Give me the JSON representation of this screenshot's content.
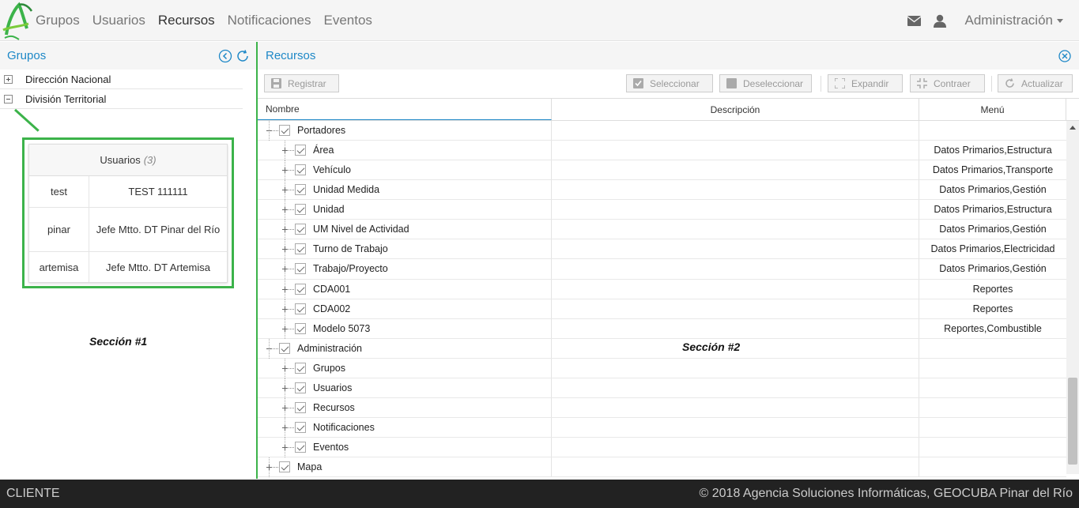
{
  "nav": {
    "items": [
      "Grupos",
      "Usuarios",
      "Recursos",
      "Notificaciones",
      "Eventos"
    ],
    "active": "Recursos",
    "admin_label": "Administración"
  },
  "left_panel": {
    "title": "Grupos",
    "tree": [
      "Dirección Nacional",
      "División Territorial"
    ],
    "popup": {
      "title": "Usuarios",
      "count": "(3)",
      "rows": [
        {
          "user": "test",
          "name": "TEST 111111"
        },
        {
          "user": "pinar",
          "name": "Jefe Mtto. DT Pinar del Río"
        },
        {
          "user": "artemisa",
          "name": "Jefe Mtto. DT Artemisa"
        }
      ]
    },
    "section_label": "Sección #1"
  },
  "right_panel": {
    "title": "Recursos",
    "toolbar": {
      "registrar": "Registrar",
      "seleccionar": "Seleccionar",
      "deseleccionar": "Deseleccionar",
      "expandir": "Expandir",
      "contraer": "Contraer",
      "actualizar": "Actualizar"
    },
    "columns": {
      "name": "Nombre",
      "desc": "Descripción",
      "menu": "Menú"
    },
    "rows": [
      {
        "level": 0,
        "name": "Portadores",
        "menu": "",
        "expanded": true
      },
      {
        "level": 1,
        "name": "Área",
        "menu": "Datos Primarios,Estructura"
      },
      {
        "level": 1,
        "name": "Vehículo",
        "menu": "Datos Primarios,Transporte"
      },
      {
        "level": 1,
        "name": "Unidad Medida",
        "menu": "Datos Primarios,Gestión"
      },
      {
        "level": 1,
        "name": "Unidad",
        "menu": "Datos Primarios,Estructura"
      },
      {
        "level": 1,
        "name": "UM Nivel de Actividad",
        "menu": "Datos Primarios,Gestión"
      },
      {
        "level": 1,
        "name": "Turno de Trabajo",
        "menu": "Datos Primarios,Electricidad"
      },
      {
        "level": 1,
        "name": "Trabajo/Proyecto",
        "menu": "Datos Primarios,Gestión"
      },
      {
        "level": 1,
        "name": "CDA001",
        "menu": "Reportes"
      },
      {
        "level": 1,
        "name": "CDA002",
        "menu": "Reportes"
      },
      {
        "level": 1,
        "name": "Modelo 5073",
        "menu": "Reportes,Combustible"
      },
      {
        "level": 0,
        "name": "Administración",
        "menu": "",
        "expanded": true
      },
      {
        "level": 1,
        "name": "Grupos",
        "menu": ""
      },
      {
        "level": 1,
        "name": "Usuarios",
        "menu": ""
      },
      {
        "level": 1,
        "name": "Recursos",
        "menu": ""
      },
      {
        "level": 1,
        "name": "Notificaciones",
        "menu": ""
      },
      {
        "level": 1,
        "name": "Eventos",
        "menu": ""
      },
      {
        "level": 0,
        "name": "Mapa",
        "menu": "",
        "expanded": false
      }
    ],
    "section_label": "Sección #2"
  },
  "footer": {
    "left": "CLIENTE",
    "right": "© 2018 Agencia Soluciones Informáticas, GEOCUBA Pinar del Río"
  },
  "colors": {
    "accent": "#1e88c7",
    "highlight": "#3cb34a",
    "footer_bg": "#222222"
  }
}
